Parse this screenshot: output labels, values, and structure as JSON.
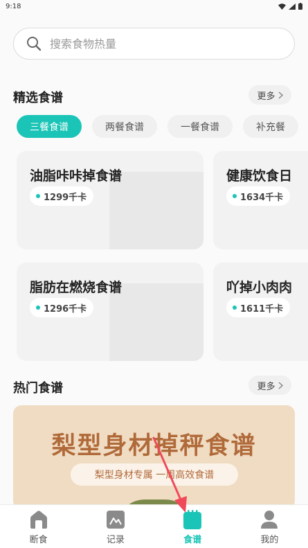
{
  "status_bar": {
    "time": "9:18"
  },
  "search": {
    "placeholder": "搜索食物热量"
  },
  "featured": {
    "title": "精选食谱",
    "more_label": "更多",
    "tabs": [
      {
        "label": "三餐食谱",
        "active": true
      },
      {
        "label": "两餐食谱",
        "active": false
      },
      {
        "label": "一餐食谱",
        "active": false
      },
      {
        "label": "补充餐",
        "active": false
      }
    ],
    "cards": [
      {
        "title": "油脂咔咔掉食谱",
        "kcal": "1299千卡"
      },
      {
        "title": "健康饮食日",
        "kcal": "1634千卡"
      },
      {
        "title": "脂肪在燃烧食谱",
        "kcal": "1296千卡"
      },
      {
        "title": "吖掉小肉肉",
        "kcal": "1611千卡"
      }
    ]
  },
  "hot": {
    "title": "热门食谱",
    "more_label": "更多",
    "banner": {
      "title": "梨型身材掉秤食谱",
      "subtitle": "梨型身材专属 一周高效食谱"
    }
  },
  "tabbar": {
    "items": [
      {
        "label": "断食",
        "icon": "home-icon",
        "active": false
      },
      {
        "label": "记录",
        "icon": "record-icon",
        "active": false
      },
      {
        "label": "食谱",
        "icon": "recipe-icon",
        "active": true
      },
      {
        "label": "我的",
        "icon": "profile-icon",
        "active": false
      }
    ]
  },
  "colors": {
    "accent": "#1ac4b6",
    "annotation_arrow": "#f04a5a",
    "banner_bg": "#f0dcc3",
    "banner_text": "#b06a3a"
  }
}
